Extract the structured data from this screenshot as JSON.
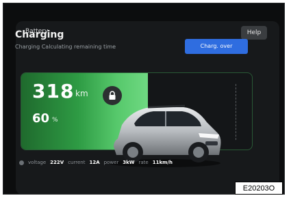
{
  "header": {
    "title": "Battery",
    "help_label": "Help"
  },
  "status": {
    "title": "Charging",
    "subtitle": "Charging Calculating remaining time",
    "button_label": "Charg. over"
  },
  "battery": {
    "range_value": "318",
    "range_unit": "km",
    "percent_value": "60",
    "percent_unit": "%",
    "level_fraction": 0.55
  },
  "footer": {
    "voltage_label": "voltage",
    "voltage_value": "222V",
    "current_label": "current",
    "current_value": "12A",
    "power_label": "power",
    "power_value": "3kW",
    "rate_label": "rate",
    "rate_value": "11km/h"
  },
  "figure_code": "E20203O",
  "colors": {
    "accent": "#2f6de0",
    "battery_fill": "#2e9b44",
    "background": "#17191b"
  },
  "icons": [
    "lock-icon",
    "info-icon",
    "car-image"
  ]
}
